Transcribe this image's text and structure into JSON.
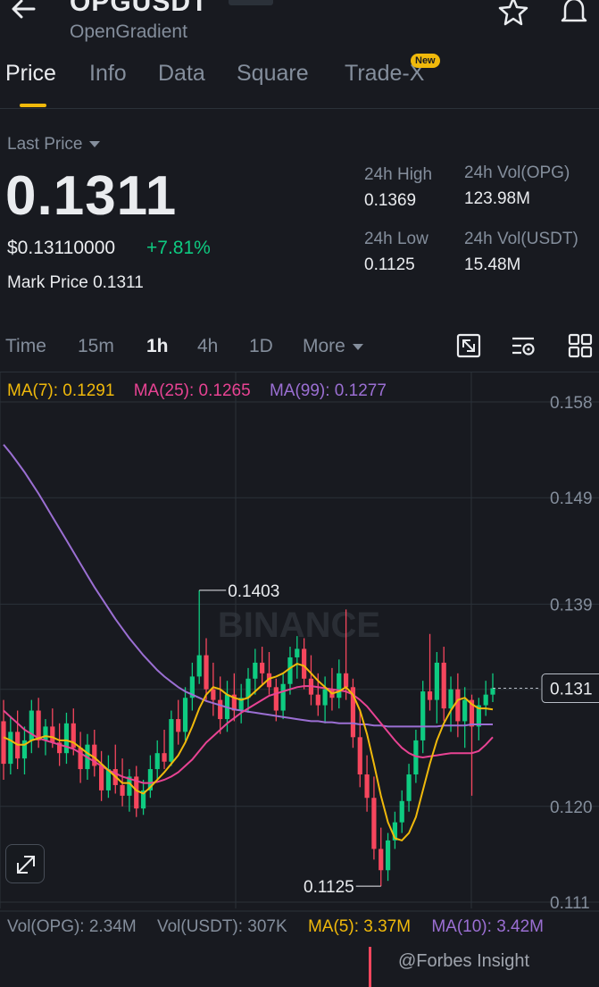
{
  "header": {
    "pair": "OPGUSDT",
    "subtitle": "OpenGradient"
  },
  "tabs": [
    {
      "label": "Price",
      "active": true
    },
    {
      "label": "Info"
    },
    {
      "label": "Data"
    },
    {
      "label": "Square"
    },
    {
      "label": "Trade-X",
      "badge": "New"
    }
  ],
  "ticker": {
    "last_price_label": "Last Price",
    "last_price": "0.1311",
    "usd_price": "$0.13110000",
    "change": "+7.81%",
    "mark_label": "Mark Price",
    "mark_price": "0.1311",
    "high_label": "24h High",
    "high": "0.1369",
    "low_label": "24h Low",
    "low": "0.1125",
    "vol_base_label": "24h Vol(OPG)",
    "vol_base": "123.98M",
    "vol_quote_label": "24h Vol(USDT)",
    "vol_quote": "15.48M"
  },
  "intervals": [
    {
      "label": "Time"
    },
    {
      "label": "15m"
    },
    {
      "label": "1h",
      "active": true
    },
    {
      "label": "4h"
    },
    {
      "label": "1D"
    },
    {
      "label": "More"
    }
  ],
  "indicators": {
    "ma7": "MA(7): 0.1291",
    "ma25": "MA(25): 0.1265",
    "ma99": "MA(99): 0.1277"
  },
  "volume": {
    "vol_base": "Vol(OPG): 2.34M",
    "vol_quote": "Vol(USDT): 307K",
    "ma5": "MA(5): 3.37M",
    "ma10": "MA(10): 3.42M"
  },
  "watermark": "@Forbes Insight",
  "colors": {
    "up": "#0ecb81",
    "down": "#f6465d",
    "ma7": "#f0b90b",
    "ma25": "#e84393",
    "ma99": "#9b6fd3",
    "accent": "#f0b90b"
  },
  "chart_data": {
    "type": "candlestick",
    "y_tick_labels": [
      "0.158",
      "0.149",
      "0.139",
      "0.131",
      "0.120",
      "0.111"
    ],
    "ylim": [
      0.111,
      0.158
    ],
    "current_price_label": "0.131",
    "annotations": {
      "high": "0.1403",
      "low": "0.1125"
    },
    "watermark_text": "BINANCE",
    "candles": [
      {
        "o": 0.128,
        "h": 0.13,
        "l": 0.1225,
        "c": 0.124
      },
      {
        "o": 0.124,
        "h": 0.1285,
        "l": 0.123,
        "c": 0.127
      },
      {
        "o": 0.127,
        "h": 0.129,
        "l": 0.1235,
        "c": 0.1245
      },
      {
        "o": 0.1245,
        "h": 0.1275,
        "l": 0.123,
        "c": 0.1262
      },
      {
        "o": 0.1262,
        "h": 0.13,
        "l": 0.125,
        "c": 0.129
      },
      {
        "o": 0.129,
        "h": 0.1302,
        "l": 0.1255,
        "c": 0.1262
      },
      {
        "o": 0.1262,
        "h": 0.1282,
        "l": 0.1248,
        "c": 0.1275
      },
      {
        "o": 0.1275,
        "h": 0.1292,
        "l": 0.1255,
        "c": 0.126
      },
      {
        "o": 0.126,
        "h": 0.1278,
        "l": 0.1238,
        "c": 0.125
      },
      {
        "o": 0.125,
        "h": 0.1288,
        "l": 0.124,
        "c": 0.1278
      },
      {
        "o": 0.1278,
        "h": 0.1292,
        "l": 0.1248,
        "c": 0.1255
      },
      {
        "o": 0.1255,
        "h": 0.127,
        "l": 0.1222,
        "c": 0.1235
      },
      {
        "o": 0.1235,
        "h": 0.1268,
        "l": 0.1225,
        "c": 0.1258
      },
      {
        "o": 0.1258,
        "h": 0.1272,
        "l": 0.1228,
        "c": 0.1238
      },
      {
        "o": 0.1238,
        "h": 0.1252,
        "l": 0.1205,
        "c": 0.1215
      },
      {
        "o": 0.1215,
        "h": 0.1248,
        "l": 0.1208,
        "c": 0.1235
      },
      {
        "o": 0.1235,
        "h": 0.1258,
        "l": 0.1212,
        "c": 0.122
      },
      {
        "o": 0.122,
        "h": 0.1245,
        "l": 0.12,
        "c": 0.121
      },
      {
        "o": 0.121,
        "h": 0.1235,
        "l": 0.1195,
        "c": 0.1228
      },
      {
        "o": 0.1228,
        "h": 0.1238,
        "l": 0.119,
        "c": 0.1198
      },
      {
        "o": 0.1198,
        "h": 0.1225,
        "l": 0.1192,
        "c": 0.1215
      },
      {
        "o": 0.1215,
        "h": 0.1248,
        "l": 0.1208,
        "c": 0.1235
      },
      {
        "o": 0.1235,
        "h": 0.1262,
        "l": 0.1225,
        "c": 0.125
      },
      {
        "o": 0.125,
        "h": 0.1272,
        "l": 0.1235,
        "c": 0.1242
      },
      {
        "o": 0.1242,
        "h": 0.129,
        "l": 0.1238,
        "c": 0.1282
      },
      {
        "o": 0.1282,
        "h": 0.13,
        "l": 0.1258,
        "c": 0.127
      },
      {
        "o": 0.127,
        "h": 0.1312,
        "l": 0.1262,
        "c": 0.1302
      },
      {
        "o": 0.1302,
        "h": 0.1335,
        "l": 0.129,
        "c": 0.1322
      },
      {
        "o": 0.1322,
        "h": 0.1403,
        "l": 0.1315,
        "c": 0.1342
      },
      {
        "o": 0.1342,
        "h": 0.1358,
        "l": 0.13,
        "c": 0.131
      },
      {
        "o": 0.131,
        "h": 0.1335,
        "l": 0.1285,
        "c": 0.13
      },
      {
        "o": 0.13,
        "h": 0.1322,
        "l": 0.1268,
        "c": 0.1282
      },
      {
        "o": 0.1282,
        "h": 0.1318,
        "l": 0.127,
        "c": 0.1305
      },
      {
        "o": 0.1305,
        "h": 0.1325,
        "l": 0.128,
        "c": 0.129
      },
      {
        "o": 0.129,
        "h": 0.1315,
        "l": 0.1278,
        "c": 0.1302
      },
      {
        "o": 0.1302,
        "h": 0.133,
        "l": 0.1288,
        "c": 0.132
      },
      {
        "o": 0.132,
        "h": 0.1348,
        "l": 0.1305,
        "c": 0.1335
      },
      {
        "o": 0.1335,
        "h": 0.135,
        "l": 0.1315,
        "c": 0.1325
      },
      {
        "o": 0.1325,
        "h": 0.1345,
        "l": 0.1305,
        "c": 0.1312
      },
      {
        "o": 0.1312,
        "h": 0.132,
        "l": 0.128,
        "c": 0.129
      },
      {
        "o": 0.129,
        "h": 0.1325,
        "l": 0.1282,
        "c": 0.1315
      },
      {
        "o": 0.1315,
        "h": 0.135,
        "l": 0.1305,
        "c": 0.134
      },
      {
        "o": 0.134,
        "h": 0.136,
        "l": 0.132,
        "c": 0.1348
      },
      {
        "o": 0.1348,
        "h": 0.1358,
        "l": 0.131,
        "c": 0.132
      },
      {
        "o": 0.132,
        "h": 0.1342,
        "l": 0.1295,
        "c": 0.1305
      },
      {
        "o": 0.1305,
        "h": 0.1325,
        "l": 0.1285,
        "c": 0.1295
      },
      {
        "o": 0.1295,
        "h": 0.1322,
        "l": 0.1278,
        "c": 0.131
      },
      {
        "o": 0.131,
        "h": 0.133,
        "l": 0.129,
        "c": 0.1302
      },
      {
        "o": 0.1302,
        "h": 0.1338,
        "l": 0.1292,
        "c": 0.1325
      },
      {
        "o": 0.1325,
        "h": 0.1385,
        "l": 0.13,
        "c": 0.1312
      },
      {
        "o": 0.1312,
        "h": 0.132,
        "l": 0.1255,
        "c": 0.1265
      },
      {
        "o": 0.1265,
        "h": 0.129,
        "l": 0.1218,
        "c": 0.123
      },
      {
        "o": 0.123,
        "h": 0.1248,
        "l": 0.1195,
        "c": 0.1208
      },
      {
        "o": 0.1208,
        "h": 0.1228,
        "l": 0.115,
        "c": 0.116
      },
      {
        "o": 0.116,
        "h": 0.118,
        "l": 0.1125,
        "c": 0.114
      },
      {
        "o": 0.114,
        "h": 0.1175,
        "l": 0.113,
        "c": 0.1168
      },
      {
        "o": 0.1168,
        "h": 0.1195,
        "l": 0.116,
        "c": 0.1185
      },
      {
        "o": 0.1185,
        "h": 0.1215,
        "l": 0.1175,
        "c": 0.1205
      },
      {
        "o": 0.1205,
        "h": 0.124,
        "l": 0.1195,
        "c": 0.123
      },
      {
        "o": 0.123,
        "h": 0.1272,
        "l": 0.1222,
        "c": 0.1262
      },
      {
        "o": 0.1262,
        "h": 0.1318,
        "l": 0.125,
        "c": 0.1308
      },
      {
        "o": 0.1308,
        "h": 0.1362,
        "l": 0.129,
        "c": 0.13
      },
      {
        "o": 0.13,
        "h": 0.1345,
        "l": 0.1278,
        "c": 0.1335
      },
      {
        "o": 0.1335,
        "h": 0.135,
        "l": 0.128,
        "c": 0.1292
      },
      {
        "o": 0.1292,
        "h": 0.1322,
        "l": 0.127,
        "c": 0.131
      },
      {
        "o": 0.131,
        "h": 0.1325,
        "l": 0.1265,
        "c": 0.128
      },
      {
        "o": 0.128,
        "h": 0.1312,
        "l": 0.1255,
        "c": 0.13
      },
      {
        "o": 0.13,
        "h": 0.1305,
        "l": 0.121,
        "c": 0.1275
      },
      {
        "o": 0.1275,
        "h": 0.1302,
        "l": 0.1262,
        "c": 0.1295
      },
      {
        "o": 0.1295,
        "h": 0.1318,
        "l": 0.1285,
        "c": 0.1305
      },
      {
        "o": 0.1305,
        "h": 0.1325,
        "l": 0.1298,
        "c": 0.1311
      }
    ],
    "ma7": [
      0.1265,
      0.1262,
      0.1258,
      0.1258,
      0.1262,
      0.1264,
      0.1266,
      0.1265,
      0.1262,
      0.1262,
      0.126,
      0.1255,
      0.125,
      0.1246,
      0.124,
      0.1234,
      0.1228,
      0.1222,
      0.1222,
      0.1215,
      0.1212,
      0.1218,
      0.1225,
      0.1232,
      0.124,
      0.1248,
      0.126,
      0.1275,
      0.1292,
      0.1305,
      0.1312,
      0.131,
      0.1305,
      0.1302,
      0.13,
      0.1302,
      0.1308,
      0.1314,
      0.132,
      0.1322,
      0.1325,
      0.133,
      0.1334,
      0.1332,
      0.1325,
      0.1318,
      0.1312,
      0.1306,
      0.1308,
      0.1312,
      0.1305,
      0.129,
      0.1268,
      0.124,
      0.121,
      0.1185,
      0.117,
      0.1168,
      0.1175,
      0.119,
      0.1215,
      0.124,
      0.1262,
      0.1278,
      0.129,
      0.13,
      0.1302,
      0.1296,
      0.1292,
      0.1292,
      0.1291
    ],
    "ma25": [
      0.129,
      0.1284,
      0.1278,
      0.1272,
      0.1268,
      0.1264,
      0.1262,
      0.126,
      0.1258,
      0.1256,
      0.1254,
      0.125,
      0.1246,
      0.1242,
      0.1238,
      0.1234,
      0.1231,
      0.1228,
      0.1226,
      0.1224,
      0.1222,
      0.1222,
      0.1223,
      0.1225,
      0.1228,
      0.1232,
      0.1238,
      0.1244,
      0.1252,
      0.126,
      0.1266,
      0.1272,
      0.1278,
      0.1283,
      0.1288,
      0.1292,
      0.1296,
      0.13,
      0.1304,
      0.1306,
      0.1308,
      0.131,
      0.1312,
      0.1313,
      0.1313,
      0.1312,
      0.1311,
      0.131,
      0.1309,
      0.1308,
      0.1305,
      0.13,
      0.1294,
      0.1286,
      0.1278,
      0.127,
      0.1262,
      0.1255,
      0.125,
      0.1247,
      0.1246,
      0.1247,
      0.1248,
      0.1249,
      0.125,
      0.125,
      0.125,
      0.125,
      0.1252,
      0.1258,
      0.1265
    ],
    "ma99": [
      0.154,
      0.1532,
      0.1523,
      0.1514,
      0.1504,
      0.1494,
      0.1483,
      0.1472,
      0.1461,
      0.145,
      0.1439,
      0.1428,
      0.1417,
      0.1406,
      0.1396,
      0.1386,
      0.1376,
      0.1367,
      0.1358,
      0.135,
      0.1342,
      0.1335,
      0.1328,
      0.1322,
      0.1317,
      0.1312,
      0.1308,
      0.1305,
      0.1302,
      0.1299,
      0.1297,
      0.1295,
      0.1293,
      0.1291,
      0.129,
      0.1289,
      0.1288,
      0.1287,
      0.1286,
      0.1285,
      0.1284,
      0.1283,
      0.1282,
      0.1281,
      0.128,
      0.128,
      0.1279,
      0.1279,
      0.1278,
      0.1278,
      0.1278,
      0.1277,
      0.1277,
      0.1276,
      0.1276,
      0.1275,
      0.1275,
      0.1275,
      0.1275,
      0.1275,
      0.1275,
      0.1275,
      0.1275,
      0.1276,
      0.1276,
      0.1276,
      0.1276,
      0.1277,
      0.1277,
      0.1277,
      0.1277
    ]
  }
}
